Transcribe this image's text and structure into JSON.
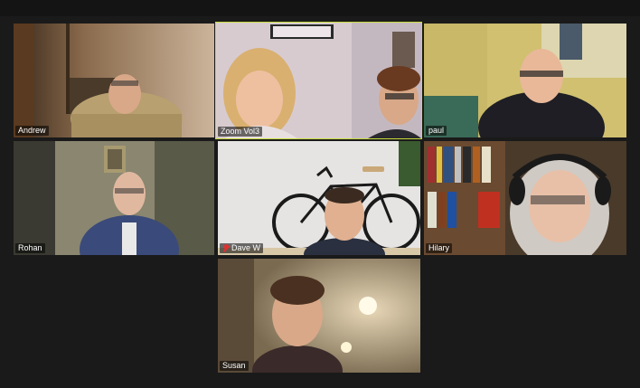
{
  "participants": [
    {
      "name": "Andrew",
      "muted": false,
      "active": false
    },
    {
      "name": "Zoom Vol3",
      "muted": false,
      "active": true
    },
    {
      "name": "paul",
      "muted": false,
      "active": false
    },
    {
      "name": "Rohan",
      "muted": false,
      "active": false
    },
    {
      "name": "Dave W",
      "muted": true,
      "active": false
    },
    {
      "name": "Hilary",
      "muted": false,
      "active": false
    },
    {
      "name": "Susan",
      "muted": false,
      "active": false
    }
  ],
  "colors": {
    "background": "#1a1a1a",
    "active_speaker_border": "#c8dc3c",
    "muted_mic": "#e03030"
  }
}
